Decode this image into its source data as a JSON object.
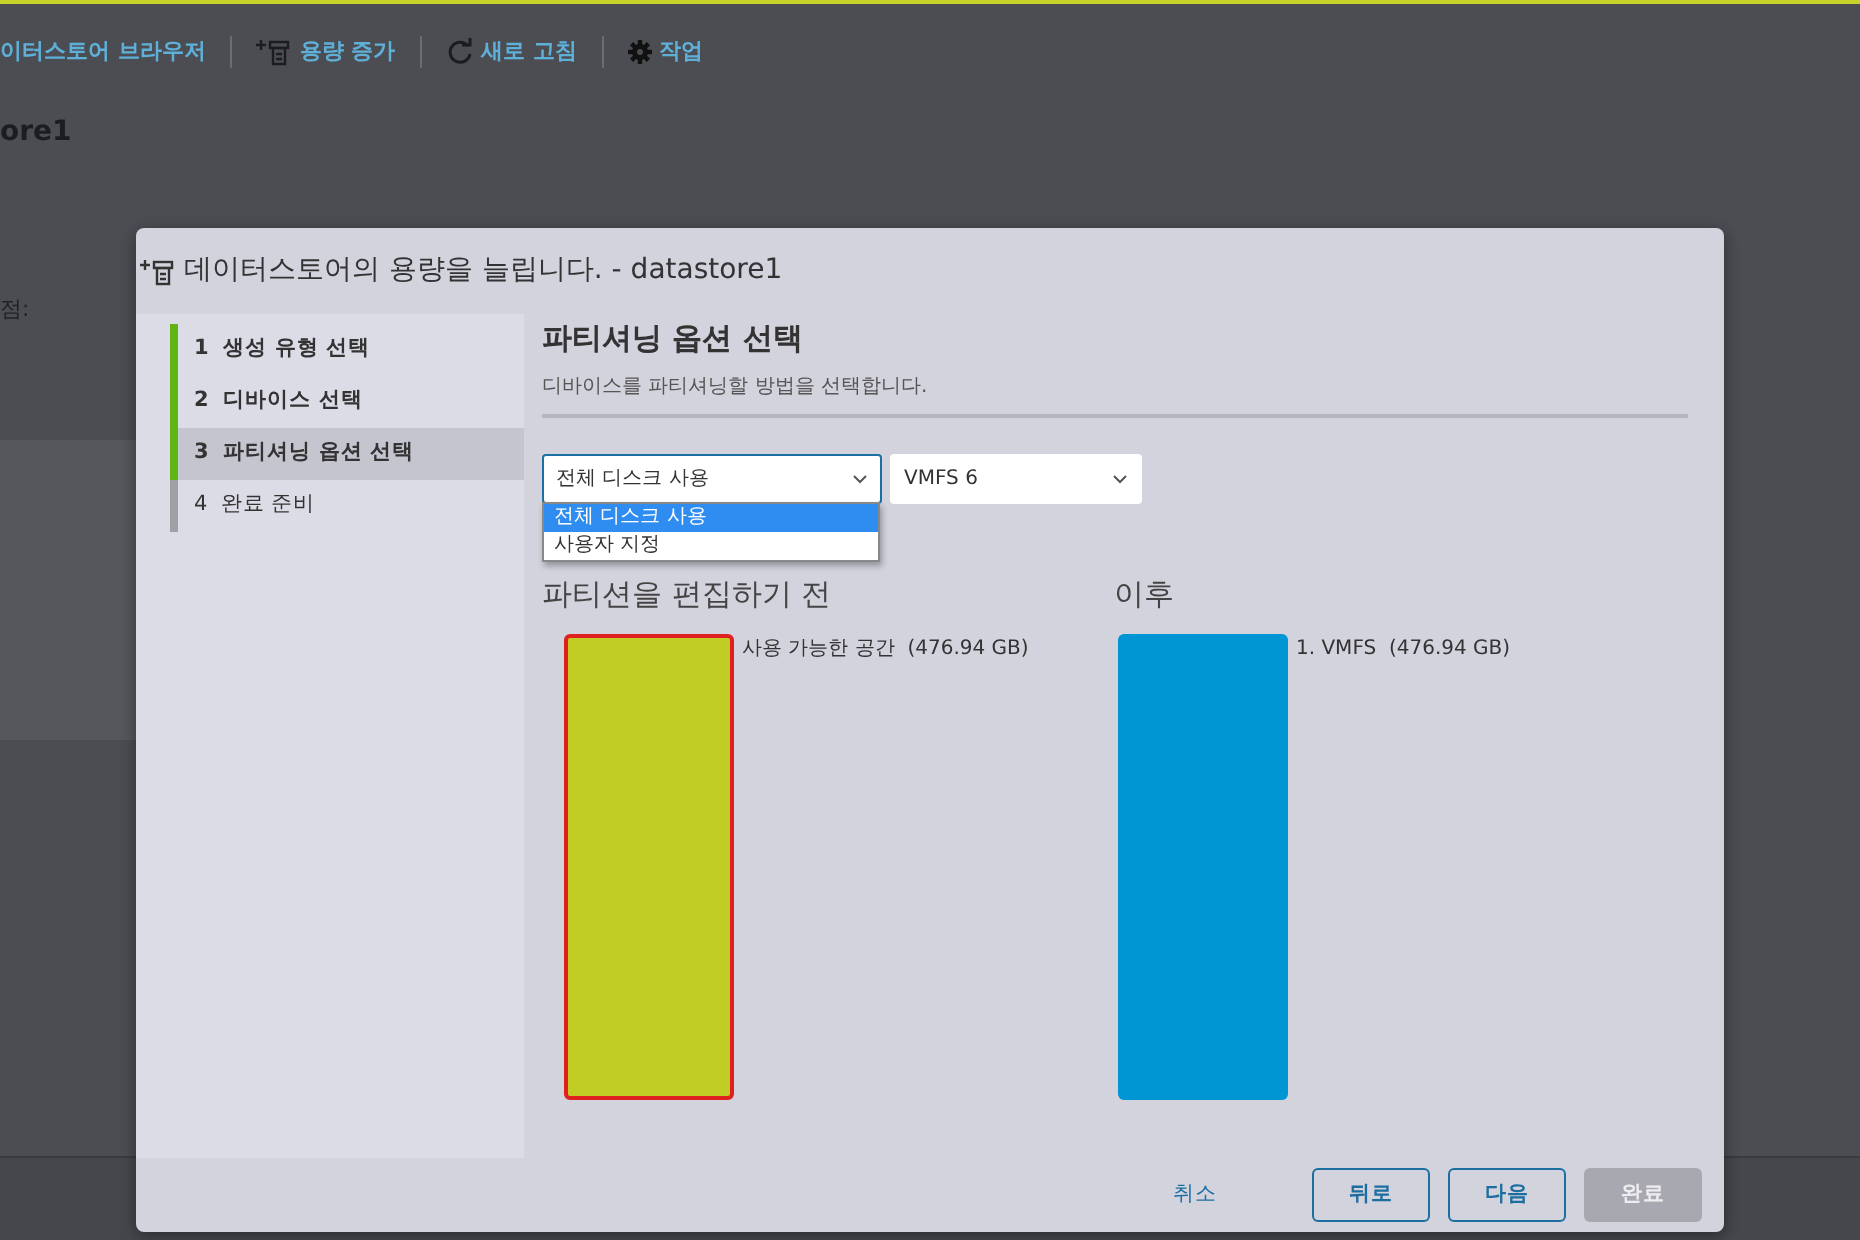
{
  "background": {
    "toolbar": [
      {
        "kind": "text",
        "label": "이터스토어 브라우저"
      },
      {
        "kind": "grow",
        "label": "용량 증가"
      },
      {
        "kind": "refresh",
        "label": "새로 고침"
      },
      {
        "kind": "gear",
        "label": "작업"
      }
    ],
    "title": "ore1",
    "field_label": "점:"
  },
  "dialog": {
    "title": "데이터스토어의 용량을 늘립니다. - datastore1",
    "steps": [
      {
        "number": "1",
        "label": "생성 유형 선택",
        "done": true,
        "selected": false
      },
      {
        "number": "2",
        "label": "디바이스 선택",
        "done": true,
        "selected": false
      },
      {
        "number": "3",
        "label": "파티셔닝 옵션 선택",
        "done": true,
        "selected": true
      },
      {
        "number": "4",
        "label": "완료 준비",
        "done": false,
        "selected": false
      }
    ],
    "heading": "파티셔닝 옵션 선택",
    "description": "디바이스를 파티셔닝할 방법을 선택합니다.",
    "partition_select": {
      "value": "전체 디스크 사용",
      "expanded": true,
      "options": [
        {
          "label": "전체 디스크 사용",
          "selected": true
        },
        {
          "label": "사용자 지정",
          "selected": false
        }
      ]
    },
    "version_select": {
      "value": "VMFS 6"
    },
    "before": {
      "title": "파티션을 편집하기 전",
      "partitions": [
        {
          "label": "사용 가능한 공간  (476.94 GB)",
          "color": "#c2cd23",
          "selected": true
        }
      ]
    },
    "after": {
      "title": "이후",
      "partitions": [
        {
          "label": "1. VMFS  (476.94 GB)",
          "color": "#0095d3",
          "selected": false
        }
      ]
    },
    "buttons": [
      {
        "kind": "link",
        "label": "취소",
        "disabled": false
      },
      {
        "kind": "outline",
        "label": "뒤로",
        "disabled": false
      },
      {
        "kind": "outline",
        "label": "다음",
        "disabled": false
      },
      {
        "kind": "solid",
        "label": "완료",
        "disabled": true
      }
    ]
  }
}
